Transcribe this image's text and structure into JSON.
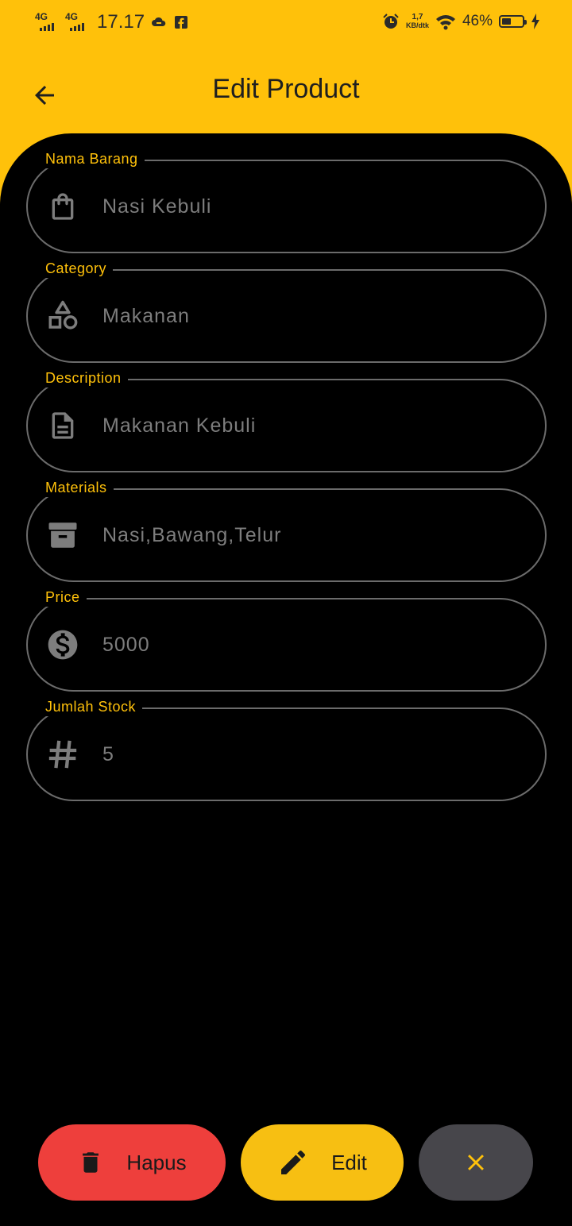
{
  "status_bar": {
    "network_1": "4G",
    "network_2": "4G",
    "time": "17.17",
    "speed_value": "1,7",
    "speed_unit": "KB/dtk",
    "battery_percent": "46%",
    "battery_level": 0.46
  },
  "app_bar": {
    "title": "Edit Product",
    "back_icon": "arrow-back-icon"
  },
  "form": {
    "fields": [
      {
        "label": "Nama Barang",
        "value": "Nasi Kebuli",
        "icon": "shopping-bag-icon"
      },
      {
        "label": "Category",
        "value": "Makanan",
        "icon": "category-shapes-icon"
      },
      {
        "label": "Description",
        "value": "Makanan Kebuli",
        "icon": "document-icon"
      },
      {
        "label": "Materials",
        "value": "Nasi,Bawang,Telur",
        "icon": "archive-box-icon"
      },
      {
        "label": "Price",
        "value": "5000",
        "icon": "dollar-circle-icon"
      },
      {
        "label": "Jumlah Stock",
        "value": "5",
        "icon": "hash-icon"
      }
    ]
  },
  "actions": {
    "delete_label": "Hapus",
    "edit_label": "Edit",
    "close_icon": "close-icon"
  },
  "colors": {
    "accent": "#FFC10A",
    "background": "#000000",
    "delete": "#EE3F3C",
    "edit": "#F7BF12",
    "close_bg": "#47464B",
    "field_text": "#7D7D7D",
    "outline": "#6B6B6B"
  }
}
